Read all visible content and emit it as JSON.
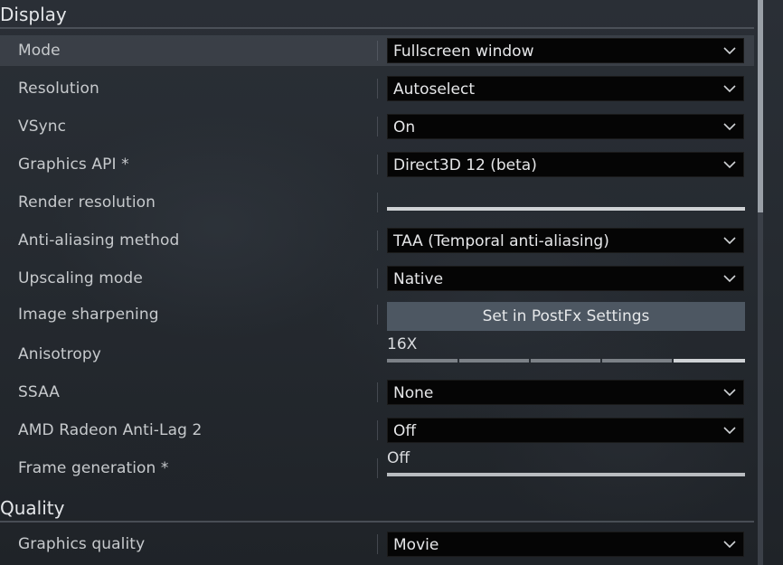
{
  "sections": {
    "display": {
      "title": "Display"
    },
    "quality": {
      "title": "Quality"
    }
  },
  "rows": {
    "mode": {
      "label": "Mode",
      "value": "Fullscreen window"
    },
    "resolution": {
      "label": "Resolution",
      "value": "Autoselect"
    },
    "vsync": {
      "label": "VSync",
      "value": "On"
    },
    "graphics_api": {
      "label": "Graphics API *",
      "value": "Direct3D 12 (beta)"
    },
    "render_resolution": {
      "label": "Render resolution",
      "fill_fraction": 1.0
    },
    "anti_aliasing": {
      "label": "Anti-aliasing method",
      "value": "TAA (Temporal anti-aliasing)"
    },
    "upscaling": {
      "label": "Upscaling mode",
      "value": "Native"
    },
    "sharpening": {
      "label": "Image sharpening",
      "button": "Set in PostFx Settings"
    },
    "anisotropy": {
      "label": "Anisotropy",
      "value": "16X",
      "level": 5,
      "levels": 5
    },
    "ssaa": {
      "label": "SSAA",
      "value": "None"
    },
    "anti_lag": {
      "label": "AMD Radeon Anti-Lag 2",
      "value": "Off"
    },
    "frame_generation": {
      "label": "Frame generation *",
      "value": "Off",
      "fill_fraction": 0.0
    },
    "graphics_quality": {
      "label": "Graphics quality",
      "value": "Movie"
    }
  },
  "icons": {
    "dropdown": "chevron-down-icon"
  },
  "colors": {
    "dropdown_bg": "#050505",
    "button_bg": "#4d5762",
    "slider_fill": "#cfd2d5"
  }
}
